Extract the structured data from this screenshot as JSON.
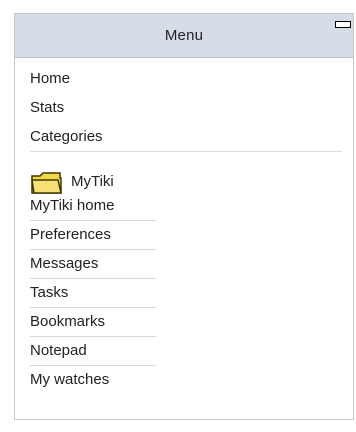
{
  "menu": {
    "title": "Menu",
    "top_items": [
      {
        "label": "Home"
      },
      {
        "label": "Stats"
      },
      {
        "label": "Categories"
      }
    ],
    "section": {
      "title": "MyTiki",
      "icon": "folder-icon",
      "items": [
        {
          "label": "MyTiki home"
        },
        {
          "label": "Preferences"
        },
        {
          "label": "Messages"
        },
        {
          "label": "Tasks"
        },
        {
          "label": "Bookmarks"
        },
        {
          "label": "Notepad"
        },
        {
          "label": "My watches"
        }
      ]
    }
  },
  "colors": {
    "header_background": "#d7dde6",
    "module_border": "#c8c8c8",
    "text": "#222222",
    "folder_fill": "#f2d84a",
    "folder_stroke": "#3f3700"
  }
}
